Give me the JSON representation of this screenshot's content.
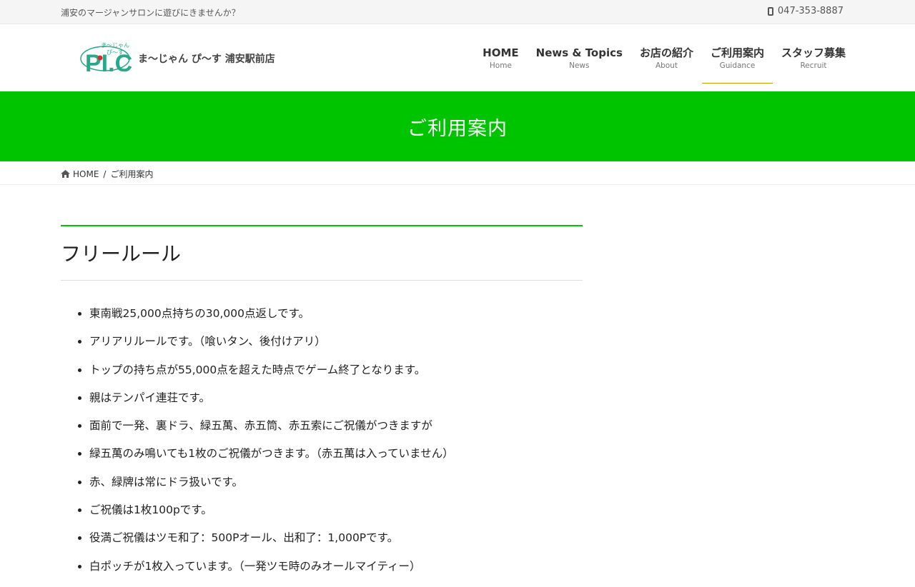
{
  "topbar": {
    "tagline": "浦安のマージャンサロンに遊びにきませんか？",
    "phone": "047-353-8887"
  },
  "header": {
    "logo_top": "ま〜じゃん",
    "logo_mid": "ぴ〜す",
    "logo_word": "PI.CE",
    "site_name": "ま〜じゃん ぴ〜す 浦安駅前店"
  },
  "nav": [
    {
      "label": "HOME",
      "sub": "Home"
    },
    {
      "label": "News & Topics",
      "sub": "News"
    },
    {
      "label": "お店の紹介",
      "sub": "About"
    },
    {
      "label": "ご利用案内",
      "sub": "Guidance"
    },
    {
      "label": "スタッフ募集",
      "sub": "Recruit"
    }
  ],
  "colors": {
    "accent": "#00c400",
    "active_underline": "#c9a200"
  },
  "banner": {
    "title": "ご利用案内"
  },
  "breadcrumb": {
    "home": "HOME",
    "separator": "/",
    "current": "ご利用案内"
  },
  "main": {
    "section_title": "フリールール",
    "rules": [
      "東南戦25,000点持ちの30,000点返しです。",
      "アリアリルールです。（喰いタン、後付けアリ）",
      "トップの持ち点が55,000点を超えた時点でゲーム終了となります。",
      "親はテンパイ連荘です。",
      "面前で一発、裏ドラ、緑五萬、赤五筒、赤五索にご祝儀がつきますが",
      "緑五萬のみ鳴いても1枚のご祝儀がつきます。（赤五萬は入っていません）",
      "赤、緑牌は常にドラ扱いです。",
      "ご祝儀は1枚100pです。",
      "役満ご祝儀はツモ和了：500Pオール、出和了：1,000Pです。",
      "白ポッチが1枚入っています。（一発ツモ時のみオールマイティー）"
    ]
  }
}
